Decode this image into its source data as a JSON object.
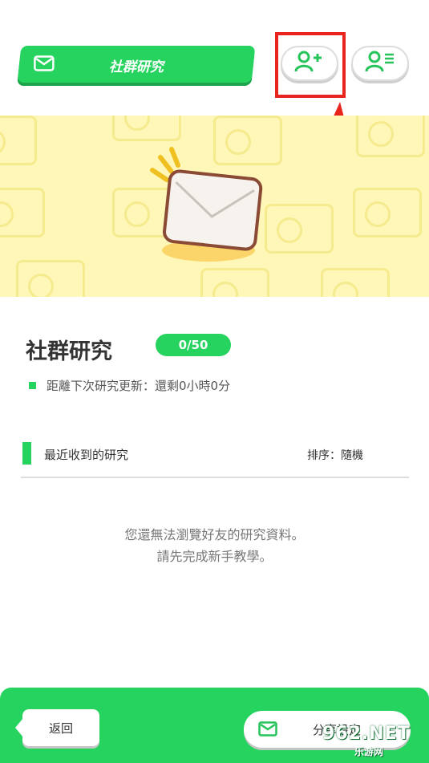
{
  "header": {
    "title": "社群研究",
    "add_friend_icon": "person-add-icon",
    "friend_list_icon": "person-list-icon"
  },
  "research": {
    "title": "社群研究",
    "counter": "0/50",
    "timer_text": "距離下次研究更新：還剩0小時0分"
  },
  "received": {
    "label": "最近收到的研究",
    "sort": "排序：隨機"
  },
  "empty_message": {
    "line1": "您還無法瀏覽好友的研究資料。",
    "line2": "請先完成新手教學。"
  },
  "footer": {
    "back_label": "返回",
    "share_label": "分享設定"
  },
  "watermark": {
    "main": "962.NET",
    "sub": "乐游网"
  },
  "colors": {
    "accent": "#26d35f",
    "banner": "#fff7b8",
    "highlight": "#e8241d"
  }
}
